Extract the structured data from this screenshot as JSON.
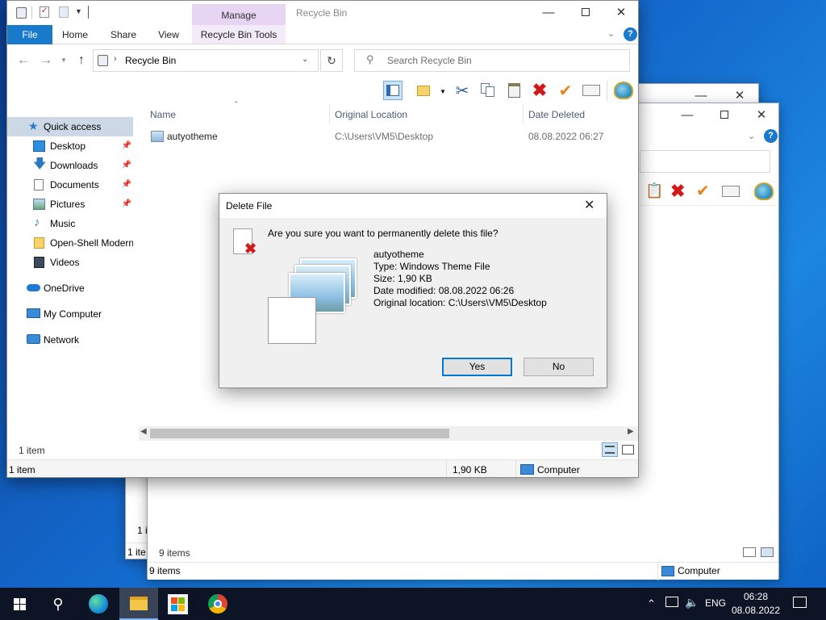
{
  "main_window": {
    "title": "Recycle Bin",
    "contextual_tab_group": "Manage",
    "tabs": [
      "File",
      "Home",
      "Share",
      "View",
      "Recycle Bin Tools"
    ],
    "address": "Recycle Bin",
    "search_placeholder": "Search Recycle Bin",
    "columns": [
      "Name",
      "Original Location",
      "Date Deleted"
    ],
    "rows": [
      {
        "name": "autyotheme",
        "original_location": "C:\\Users\\VM5\\Desktop",
        "date_deleted": "08.08.2022 06:27"
      }
    ],
    "nav": {
      "quick_access": "Quick access",
      "items": [
        "Desktop",
        "Downloads",
        "Documents",
        "Pictures",
        "Music",
        "Open-Shell Modern",
        "Videos"
      ],
      "onedrive": "OneDrive",
      "my_computer": "My Computer",
      "network": "Network"
    },
    "item_count_inner": "1 item",
    "status": {
      "items": "1 item",
      "size": "1,90 KB",
      "location": "Computer"
    }
  },
  "bg_window": {
    "status_items_inner": "9 items",
    "status_items": "9 items",
    "status_location": "Computer",
    "left_fragment_1": "1 i",
    "left_fragment_2": "1 ite"
  },
  "dialog": {
    "title": "Delete File",
    "question": "Are you sure you want to permanently delete this file?",
    "file_name": "autyotheme",
    "type": "Type: Windows Theme File",
    "size": "Size: 1,90 KB",
    "date_modified": "Date modified: 08.08.2022 06:26",
    "original_location": "Original location: C:\\Users\\VM5\\Desktop",
    "yes": "Yes",
    "no": "No"
  },
  "taskbar": {
    "language": "ENG",
    "time": "06:28",
    "date": "08.08.2022"
  },
  "colors": {
    "accent": "#1979ca",
    "manage_tab": "#e8d5f4",
    "dialog_default_border": "#0078d7",
    "taskbar": "#0c1426"
  }
}
